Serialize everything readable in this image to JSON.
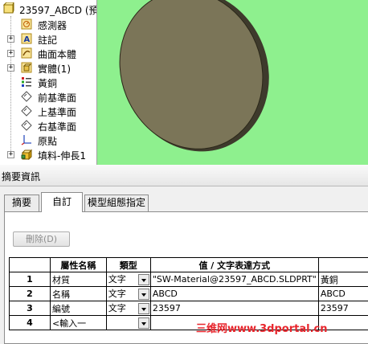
{
  "tree": {
    "root_label": "23597_ABCD (預",
    "items": [
      {
        "label": "感測器",
        "icon": "sensor-icon",
        "expander": ""
      },
      {
        "label": "註記",
        "icon": "annotation-icon",
        "expander": "+"
      },
      {
        "label": "曲面本體",
        "icon": "surface-bodies-icon",
        "expander": "+"
      },
      {
        "label": "實體(1)",
        "icon": "solid-bodies-icon",
        "expander": "+"
      },
      {
        "label": "黃銅",
        "icon": "material-icon",
        "expander": ""
      },
      {
        "label": "前基準面",
        "icon": "plane-icon",
        "expander": ""
      },
      {
        "label": "上基準面",
        "icon": "plane-icon",
        "expander": ""
      },
      {
        "label": "右基準面",
        "icon": "plane-icon",
        "expander": ""
      },
      {
        "label": "原點",
        "icon": "origin-icon",
        "expander": ""
      },
      {
        "label": "填料-伸長1",
        "icon": "extrude-icon",
        "expander": "+"
      }
    ]
  },
  "dialog": {
    "title": "摘要資訊",
    "tabs": [
      "摘要",
      "自訂",
      "模型組態指定"
    ],
    "active_tab": 1,
    "delete_button": "刪除(D)",
    "grid": {
      "headers": [
        "",
        "屬性名稱",
        "類型",
        "值 / 文字表達方式",
        ""
      ],
      "rows": [
        {
          "num": "1",
          "name": "材質",
          "type": "文字",
          "value": "\"SW-Material@23597_ABCD.SLDPRT\"",
          "evaluated": "黃銅"
        },
        {
          "num": "2",
          "name": "名稱",
          "type": "文字",
          "value": "ABCD",
          "evaluated": "ABCD"
        },
        {
          "num": "3",
          "name": "編號",
          "type": "文字",
          "value": "23597",
          "evaluated": "23597"
        },
        {
          "num": "4",
          "name": "<輸入一",
          "type": "",
          "value": "",
          "evaluated": ""
        }
      ]
    }
  },
  "watermark": "三维网www.3dportal.cn",
  "colors": {
    "viewport_bg": "#8ef08e",
    "part_face": "#7b7558",
    "watermark": "#e8262d"
  }
}
